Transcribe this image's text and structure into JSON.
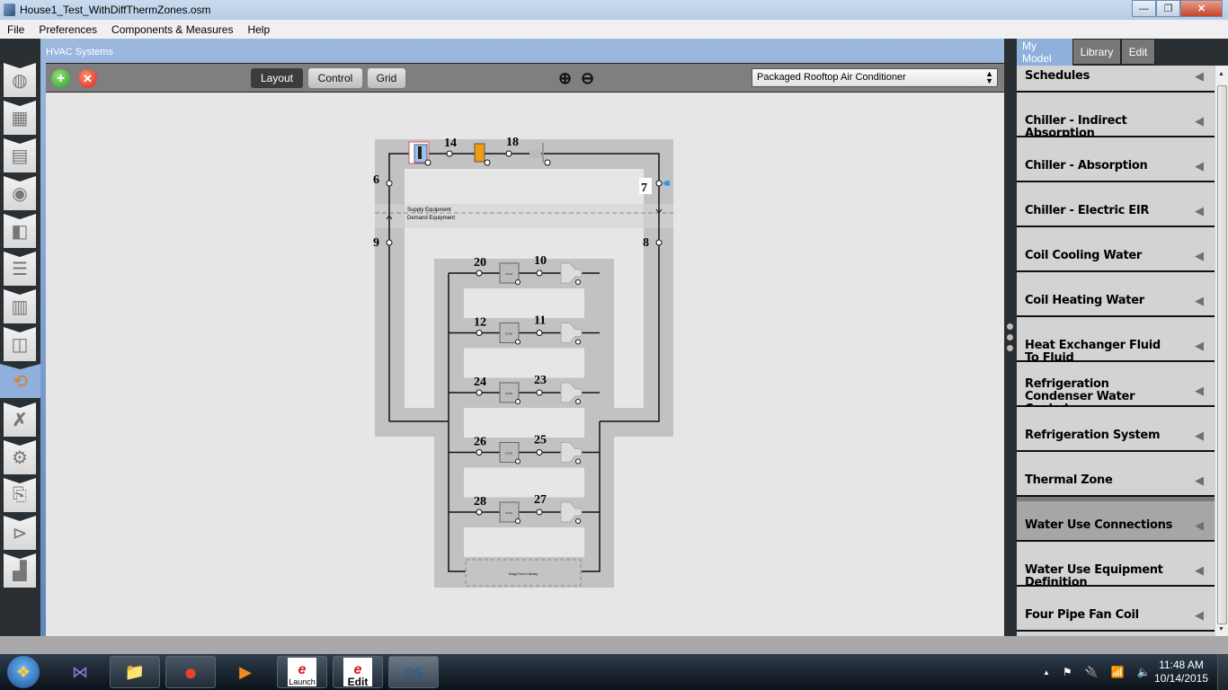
{
  "window": {
    "title": "House1_Test_WithDiffThermZones.osm",
    "controls": {
      "minimize": "—",
      "restore": "❐",
      "close": "✕"
    }
  },
  "menu": [
    "File",
    "Preferences",
    "Components & Measures",
    "Help"
  ],
  "left_nav": {
    "items": [
      {
        "name": "site",
        "icon": "globe-icon"
      },
      {
        "name": "schedules",
        "icon": "calendar-icon"
      },
      {
        "name": "constructions",
        "icon": "bricks-icon"
      },
      {
        "name": "loads",
        "icon": "outlet-icon"
      },
      {
        "name": "space-types",
        "icon": "cube-icon"
      },
      {
        "name": "geometry",
        "icon": "layers-icon"
      },
      {
        "name": "facility",
        "icon": "building-icon"
      },
      {
        "name": "spaces",
        "icon": "blocks-icon"
      },
      {
        "name": "hvac-systems",
        "icon": "loop-icon",
        "active": true
      },
      {
        "name": "variables",
        "icon": "variable-x-icon"
      },
      {
        "name": "simulation-settings",
        "icon": "gear-icon"
      },
      {
        "name": "measures",
        "icon": "scroll-icon"
      },
      {
        "name": "run",
        "icon": "play-icon"
      },
      {
        "name": "results",
        "icon": "chart-icon"
      }
    ]
  },
  "hvac": {
    "header": "HVAC Systems",
    "toolbar": {
      "add": "+",
      "remove": "✕",
      "views": [
        {
          "label": "Layout",
          "active": true
        },
        {
          "label": "Control",
          "active": false
        },
        {
          "label": "Grid",
          "active": false
        }
      ],
      "zoom_in": "⊕",
      "zoom_out": "⊖",
      "system_select": "Packaged Rooftop Air Conditioner"
    },
    "diagram": {
      "supply_nodes": [
        "14",
        "18"
      ],
      "loop_nodes": {
        "supply_inlet": "6",
        "supply_outlet": "7",
        "demand_outlet": "9",
        "demand_inlet": "8"
      },
      "supply_label": "Supply Equipment",
      "demand_label": "Demand Equipment",
      "zone_branches": [
        {
          "inlet": "20",
          "outlet": "10",
          "zone_label": "ZONE"
        },
        {
          "inlet": "12",
          "outlet": "11",
          "zone_label": "ZONE"
        },
        {
          "inlet": "24",
          "outlet": "23",
          "zone_label": "ZONE"
        },
        {
          "inlet": "26",
          "outlet": "25",
          "zone_label": "ZONE"
        },
        {
          "inlet": "28",
          "outlet": "27",
          "zone_label": "ZONE"
        }
      ],
      "drop_zone": "Drag From Library"
    }
  },
  "right_pane": {
    "tabs": [
      {
        "label": "My Model",
        "active": true
      },
      {
        "label": "Library",
        "active": false
      },
      {
        "label": "Edit",
        "active": false
      }
    ],
    "items": [
      {
        "label": "Schedules"
      },
      {
        "label": "Chiller - Indirect Absorption"
      },
      {
        "label": "Chiller - Absorption"
      },
      {
        "label": "Chiller - Electric EIR"
      },
      {
        "label": "Coil Cooling Water"
      },
      {
        "label": "Coil Heating Water"
      },
      {
        "label": "Heat Exchanger Fluid To Fluid"
      },
      {
        "label": "Refrigeration Condenser Water Cooled"
      },
      {
        "label": "Refrigeration System"
      },
      {
        "label": "Thermal Zone"
      },
      {
        "label": "Water Use Connections",
        "selected": true
      },
      {
        "label": "Water Use Equipment Definition"
      },
      {
        "label": "Four Pipe Fan Coil"
      }
    ],
    "arrow": "◀"
  },
  "taskbar": {
    "apps": [
      {
        "name": "visual-studio",
        "icon": "⋈"
      },
      {
        "name": "file-explorer",
        "icon": "📁"
      },
      {
        "name": "chrome",
        "icon": "●"
      },
      {
        "name": "media-player",
        "icon": "▶"
      },
      {
        "name": "ep-launch",
        "label": "Launch"
      },
      {
        "name": "ep-edit",
        "label": "Edit"
      },
      {
        "name": "openstudio",
        "icon": "OS"
      }
    ],
    "tray": {
      "up": "▲",
      "flag": "⚑",
      "power": "🔌",
      "signal": "📶",
      "volume": "🔈"
    },
    "time": "11:48 AM",
    "date": "10/14/2015"
  }
}
